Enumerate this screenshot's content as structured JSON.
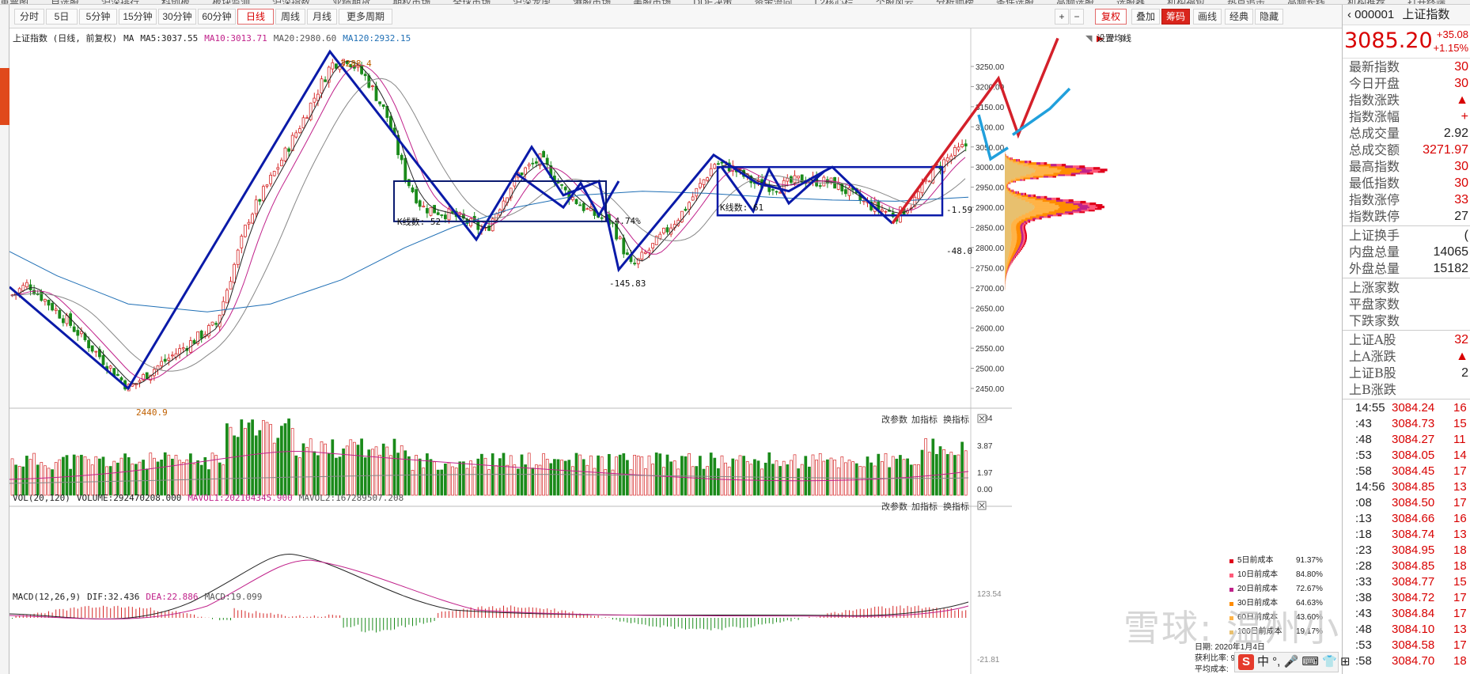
{
  "top_menu": [
    "重票图",
    "自选股",
    "沪深排行",
    "科创板",
    "板块监测",
    "沪深指数",
    "业绩期货",
    "期权市场",
    "全球市场",
    "沪深龙虎",
    "港股市场",
    "美股市场",
    "DDE决策",
    "资金流向",
    "L2核心栏",
    "个股风云",
    "分析师榜",
    "条件选股",
    "高频选股",
    "选股器",
    "机构福包",
    "热点追击",
    "高频长线",
    "机构推荐",
    "打开终端"
  ],
  "period_bar": {
    "buttons": [
      "分时",
      "5日",
      "5分钟",
      "15分钟",
      "30分钟",
      "60分钟",
      "日线",
      "周线",
      "月线",
      "更多周期"
    ],
    "active": "日线",
    "right_buttons": [
      "+",
      "−",
      "复权",
      "叠加",
      "筹码",
      "画线",
      "经典",
      "隐藏"
    ]
  },
  "main_chart": {
    "info": [
      "上证指数 (日线, 前复权)",
      "MA",
      "MA5:3037.55",
      "MA10:3013.71",
      "MA20:2980.60",
      "MA120:2932.15"
    ],
    "settings_label": "设置均线",
    "y_labels": [
      "3250.00",
      "3200.00",
      "3150.00",
      "3100.00",
      "3050.00",
      "3000.00",
      "2950.00",
      "2900.00",
      "2850.00",
      "2800.00",
      "2750.00",
      "2700.00",
      "2650.00",
      "2600.00",
      "2550.00",
      "2500.00",
      "2450.00"
    ],
    "annotations": {
      "high": "3288.4",
      "low": "2440.9",
      "box1_count": "K线数: 52",
      "box1_pct": "-4.74%",
      "box1_diff": "-145.83",
      "box2_count": "K线数: 61",
      "box2_pct": "-1.59",
      "box2_diff": "-48.0"
    }
  },
  "vol_panel": {
    "info": [
      "VOL(20,120)",
      "VOLUME:292470208.000",
      "MAVOL1:202104345.900",
      "MAVOL2:167289507.208"
    ],
    "y_labels": [
      "5.84",
      "3.87",
      "1.97",
      "0.00"
    ],
    "tools": [
      "改参数",
      "加指标",
      "换指标"
    ]
  },
  "macd_panel": {
    "info": [
      "MACD(12,26,9)",
      "DIF:32.436",
      "DEA:22.886",
      "MACD:19.099"
    ],
    "y_labels": [
      "123.54",
      "-21.81"
    ],
    "tools": [
      "改参数",
      "加指标",
      "换指标"
    ]
  },
  "cost_legend": [
    {
      "label": "5日前成本",
      "pct": "91.37%",
      "color": "#e0001b"
    },
    {
      "label": "10日前成本",
      "pct": "84.80%",
      "color": "#ff5a7a"
    },
    {
      "label": "20日前成本",
      "pct": "72.67%",
      "color": "#c0218a"
    },
    {
      "label": "30日前成本",
      "pct": "64.63%",
      "color": "#ff8c00"
    },
    {
      "label": "60日前成本",
      "pct": "43.60%",
      "color": "#ffb347"
    },
    {
      "label": "100日前成本",
      "pct": "19.17%",
      "color": "#e8c06e"
    }
  ],
  "cost_info": [
    "日期: 2020年1月4日",
    "获利比率: 99.33%",
    "平均成本:",
    "2863.06元"
  ],
  "right_panel": {
    "code": "000001",
    "name": "上证指数",
    "price": "3085.20",
    "change": "+35.08",
    "change_pct": "+1.15%",
    "rows": [
      {
        "label": "最新指数",
        "value": "30"
      },
      {
        "label": "今日开盘",
        "value": "30"
      },
      {
        "label": "指数涨跌",
        "value": "▲"
      },
      {
        "label": "指数涨幅",
        "value": "+"
      },
      {
        "label": "总成交量",
        "value": "2.92"
      },
      {
        "label": "总成交额",
        "value": "3271.97"
      },
      {
        "label": "最高指数",
        "value": "30"
      },
      {
        "label": "最低指数",
        "value": "30"
      },
      {
        "label": "指数涨停",
        "value": "33"
      },
      {
        "label": "指数跌停",
        "value": "27"
      }
    ],
    "rows2": [
      {
        "label": "上证换手",
        "value": "("
      },
      {
        "label": "内盘总量",
        "value": "14065"
      },
      {
        "label": "外盘总量",
        "value": "15182"
      }
    ],
    "rows3": [
      {
        "label": "上涨家数",
        "value": ""
      },
      {
        "label": "平盘家数",
        "value": ""
      },
      {
        "label": "下跌家数",
        "value": ""
      }
    ],
    "rows4": [
      {
        "label": "上证A股",
        "value": "32"
      },
      {
        "label": "上A涨跌",
        "value": "▲"
      },
      {
        "label": "上证B股",
        "value": "2"
      },
      {
        "label": "上B涨跌",
        "value": ""
      }
    ],
    "ticks": [
      {
        "time": "14:55",
        "price": "3084.24",
        "vol": "16"
      },
      {
        "time": ":43",
        "price": "3084.73",
        "vol": "15"
      },
      {
        "time": ":48",
        "price": "3084.27",
        "vol": "11"
      },
      {
        "time": ":53",
        "price": "3084.05",
        "vol": "14"
      },
      {
        "time": ":58",
        "price": "3084.45",
        "vol": "17"
      },
      {
        "time": "14:56",
        "price": "3084.85",
        "vol": "13"
      },
      {
        "time": ":08",
        "price": "3084.50",
        "vol": "17"
      },
      {
        "time": ":13",
        "price": "3084.66",
        "vol": "16"
      },
      {
        "time": ":18",
        "price": "3084.74",
        "vol": "13"
      },
      {
        "time": ":23",
        "price": "3084.95",
        "vol": "18"
      },
      {
        "time": ":28",
        "price": "3084.85",
        "vol": "18"
      },
      {
        "time": ":33",
        "price": "3084.77",
        "vol": "15"
      },
      {
        "time": ":38",
        "price": "3084.72",
        "vol": "17"
      },
      {
        "time": ":43",
        "price": "3084.84",
        "vol": "17"
      },
      {
        "time": ":48",
        "price": "3084.10",
        "vol": "13"
      },
      {
        "time": ":53",
        "price": "3084.58",
        "vol": "17"
      },
      {
        "time": ":58",
        "price": "3084.70",
        "vol": "18"
      }
    ]
  },
  "watermark": "雪球: 温州小孤",
  "ime": {
    "logo": "S",
    "text": "中 °, 🎤 ⌨ 👕 ⊞"
  }
}
